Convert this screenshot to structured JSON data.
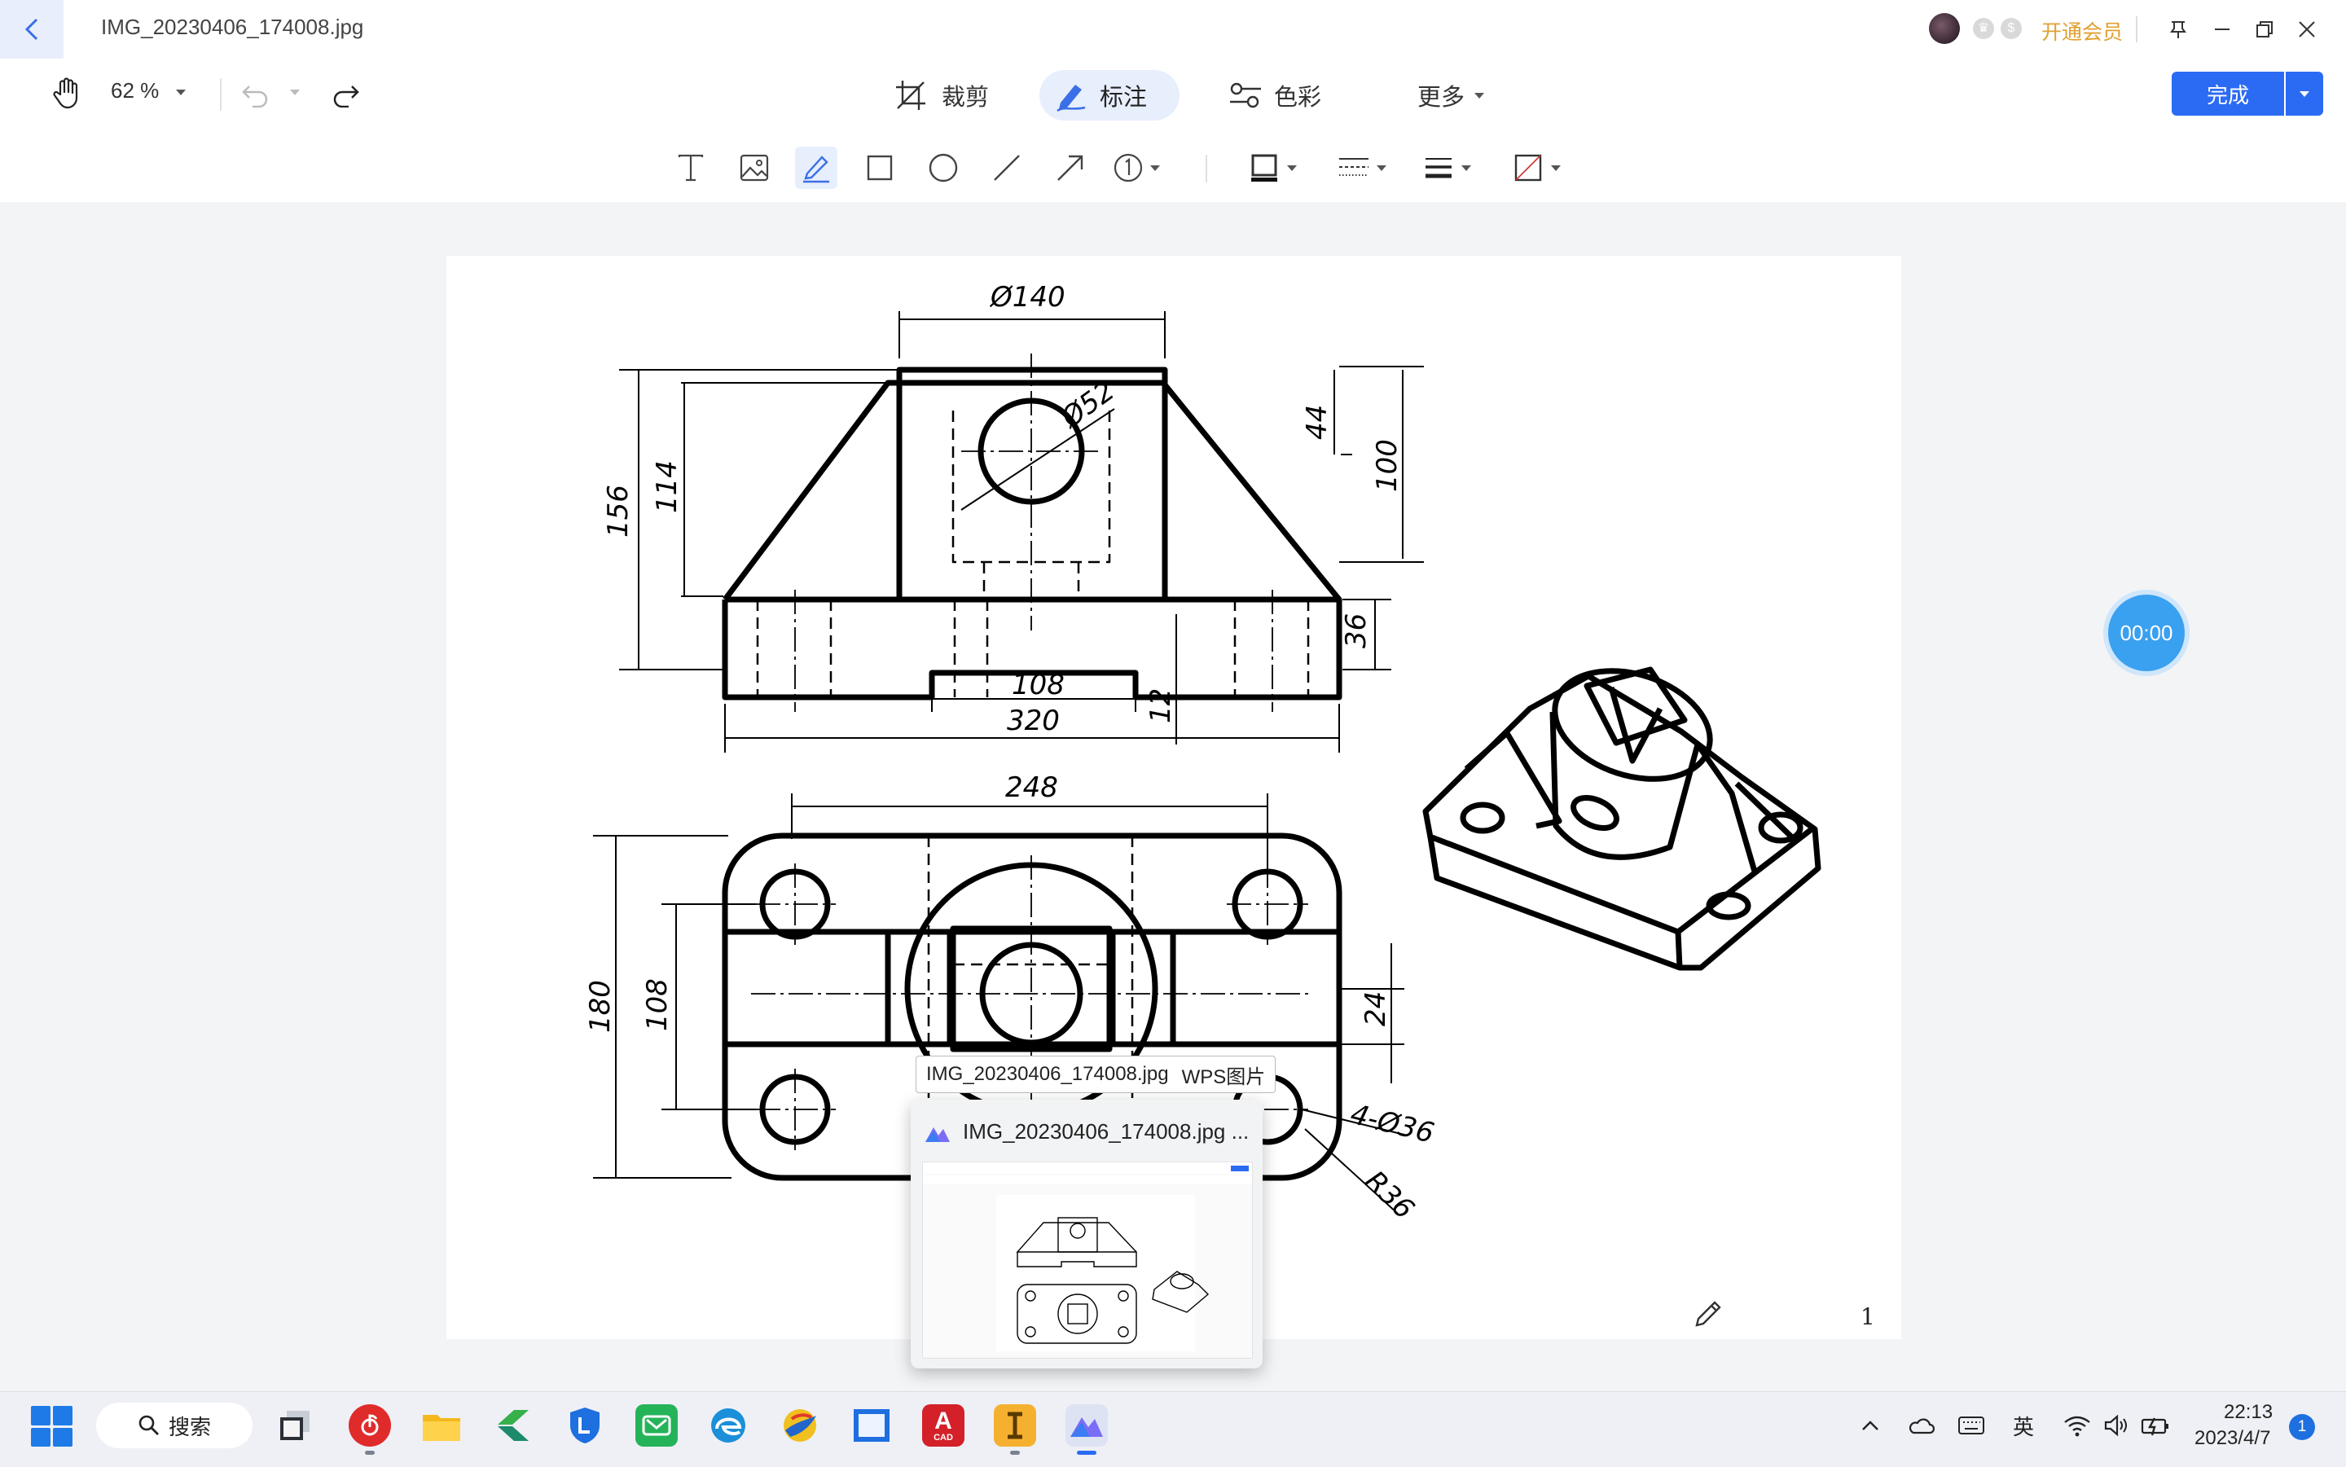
{
  "window": {
    "file_title": "IMG_20230406_174008.jpg",
    "member_label": "开通会员"
  },
  "toolbar": {
    "zoom": "62 %",
    "tabs": {
      "crop": "裁剪",
      "annotate": "标注",
      "color": "色彩",
      "more": "更多"
    },
    "done_label": "完成"
  },
  "drawing": {
    "dims": {
      "d140": "Ø140",
      "d52": "Ø52",
      "h44": "44",
      "h100": "100",
      "h156": "156",
      "h114": "114",
      "h36": "36",
      "w108": "108",
      "w320": "320",
      "h12": "12",
      "w248": "248",
      "h180": "180",
      "h108b": "108",
      "h24": "24",
      "holes": "4-Ø36",
      "r36": "R36"
    }
  },
  "page_number": "1",
  "timer": "00:00",
  "tooltip": {
    "filename": "IMG_20230406_174008.jpg",
    "app": "WPS图片"
  },
  "preview": {
    "title": "IMG_20230406_174008.jpg  ..."
  },
  "taskbar": {
    "search_label": "搜索",
    "ime": "英",
    "time": "22:13",
    "date": "2023/4/7",
    "notifications": "1",
    "cad_label": "CAD"
  }
}
